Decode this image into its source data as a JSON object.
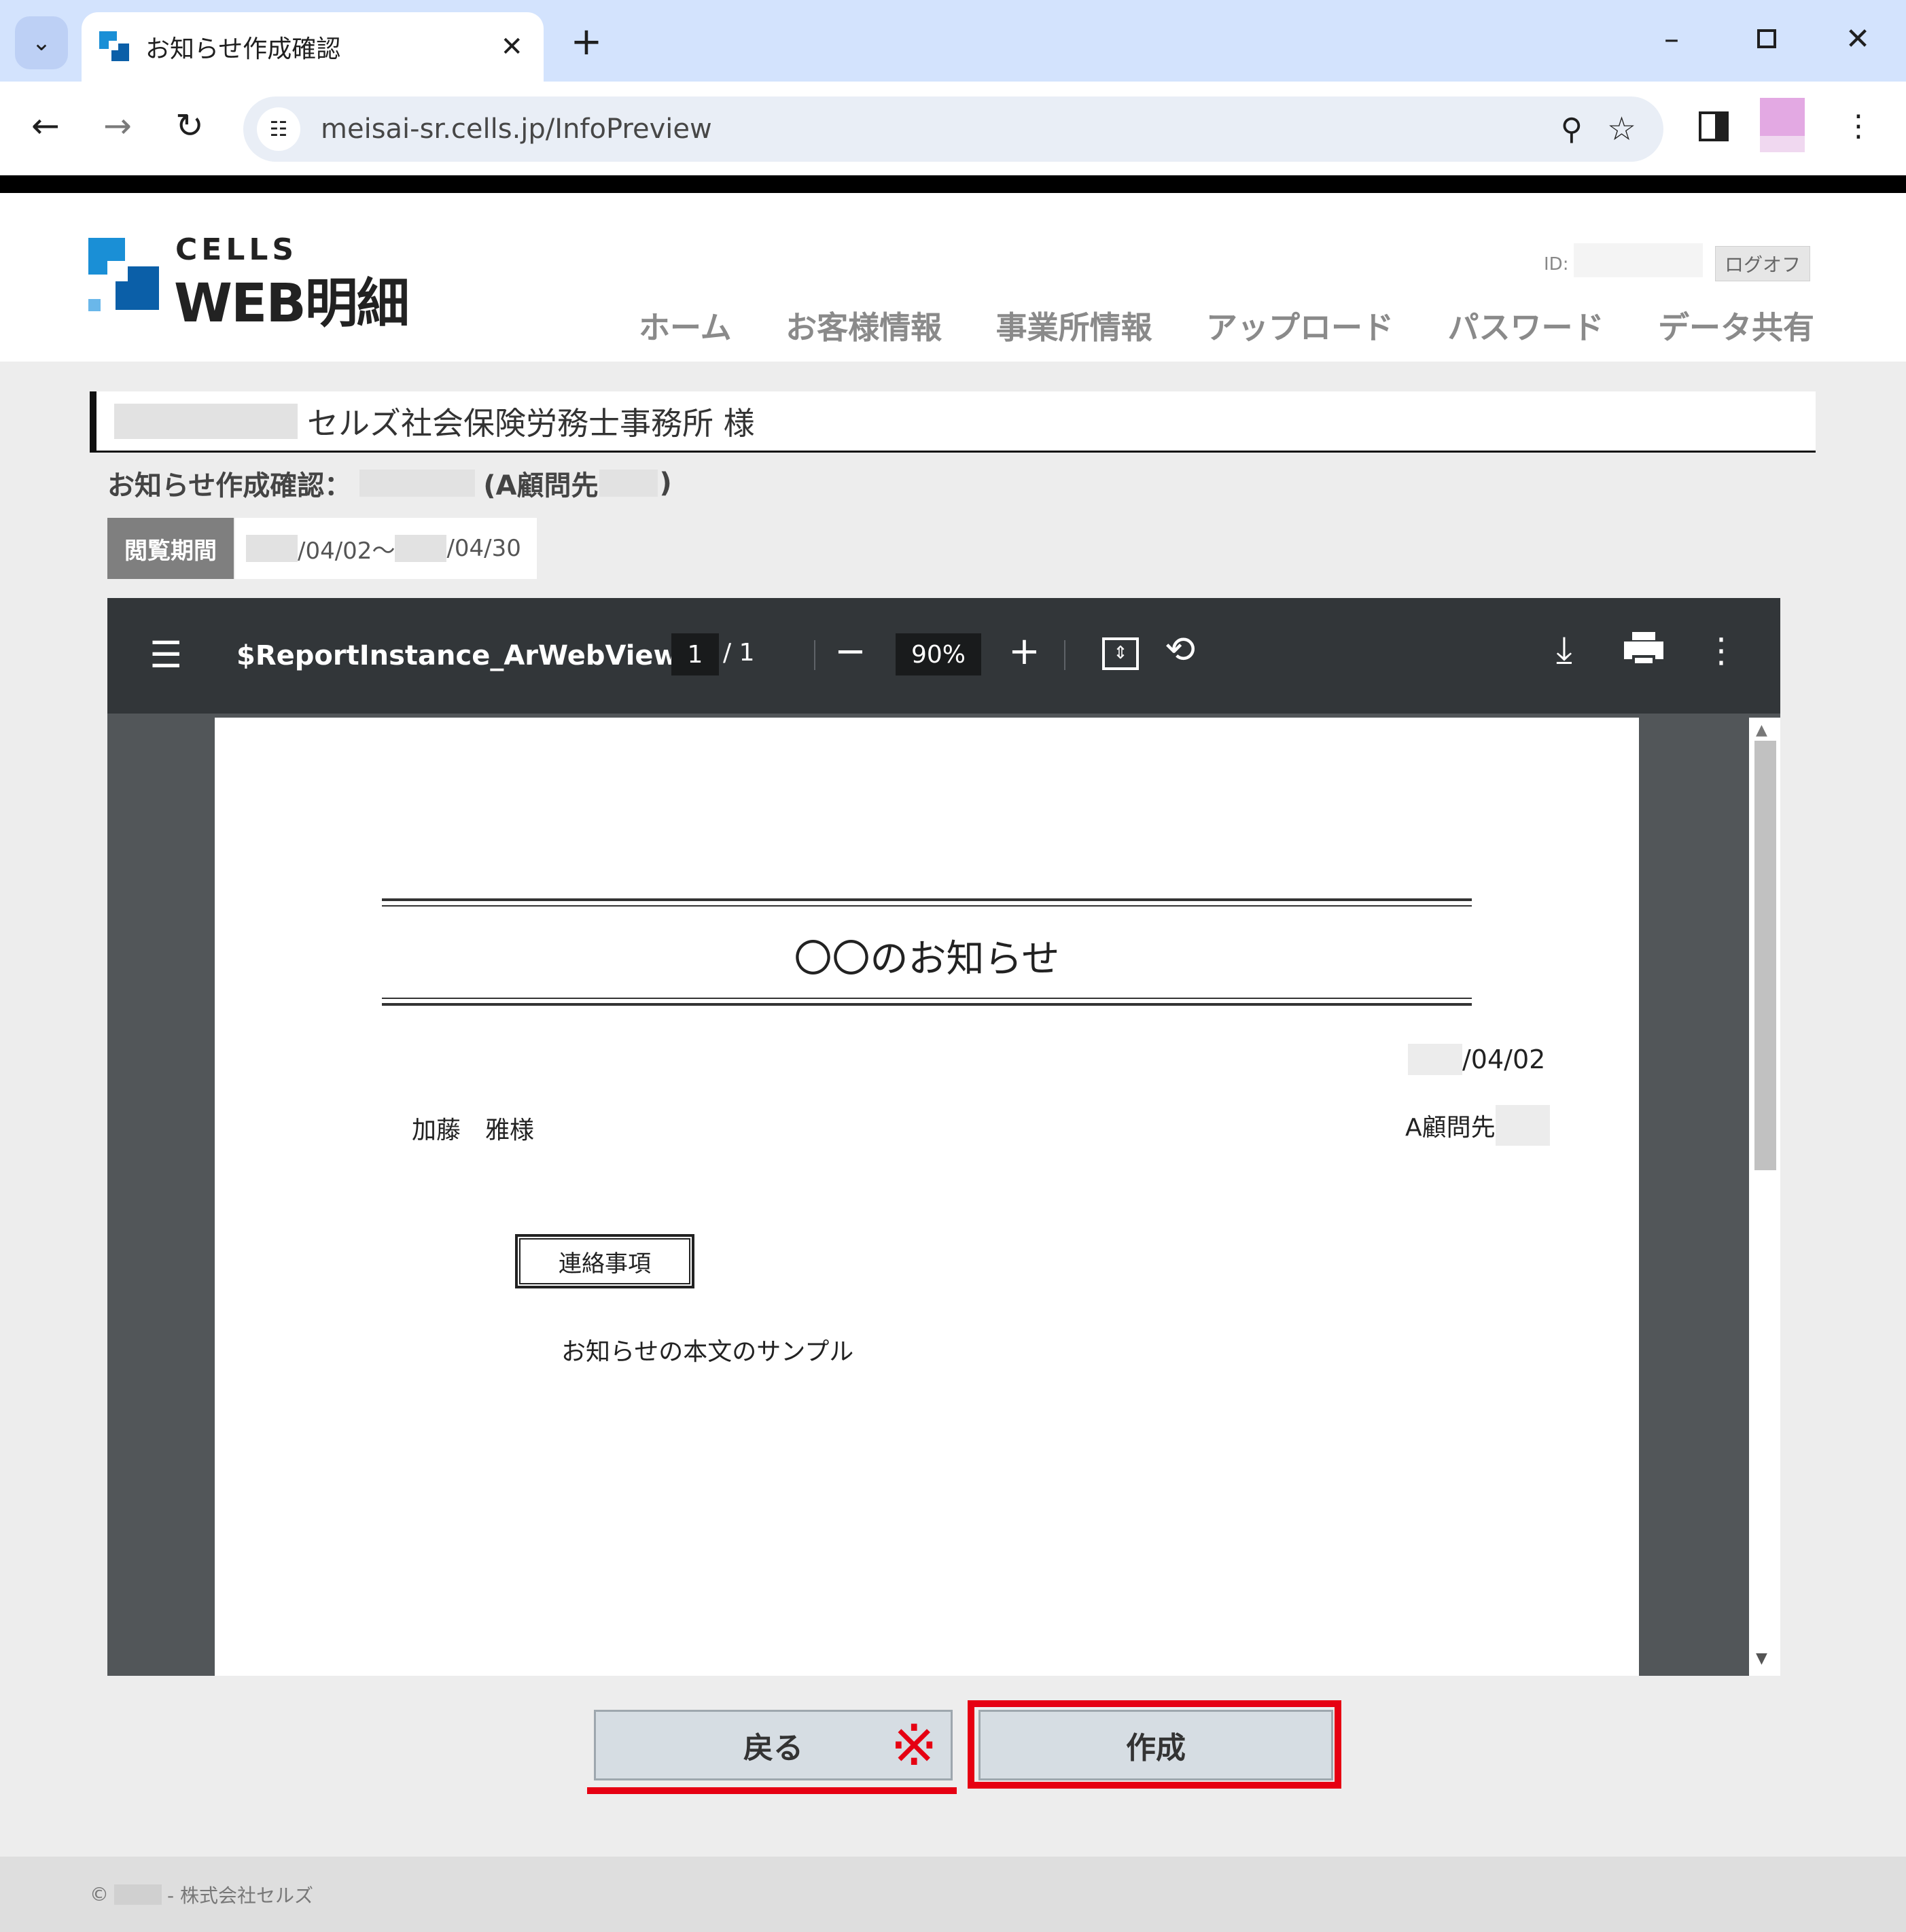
{
  "browser": {
    "tab_title": "お知らせ作成確認",
    "url": "meisai-sr.cells.jp/InfoPreview"
  },
  "header": {
    "logo_top": "CELLS",
    "logo_main": "WEB明細",
    "id_label": "ID:",
    "logoff_label": "ログオフ",
    "nav": [
      "ホーム",
      "お客様情報",
      "事業所情報",
      "アップロード",
      "パスワード",
      "データ共有"
    ]
  },
  "office": {
    "name": "セルズ社会保険労務士事務所 様"
  },
  "page": {
    "heading_prefix": "お知らせ作成確認：",
    "heading_paren_open": "(A顧問先",
    "heading_paren_close": ")",
    "period_label": "閲覧期間",
    "period_start": "/04/02～",
    "period_end": "/04/30"
  },
  "pdf_viewer": {
    "title": "$ReportInstance_ArWebView...",
    "page_current": "1",
    "page_total": "/  1",
    "zoom": "90%",
    "document": {
      "title": "〇〇のお知らせ",
      "date": "/04/02",
      "recipient": "加藤　雅様",
      "sender": "A顧問先",
      "section_label": "連絡事項",
      "body": "お知らせの本文のサンプル"
    }
  },
  "buttons": {
    "return_label": "戻る",
    "return_note_mark": "※",
    "create_label": "作成"
  },
  "footer": {
    "copyright_symbol": "©",
    "company": "- 株式会社セルズ"
  },
  "colors": {
    "highlight": "#e60012",
    "pdf_toolbar": "#323639",
    "tabstrip": "#d3e3fd"
  }
}
